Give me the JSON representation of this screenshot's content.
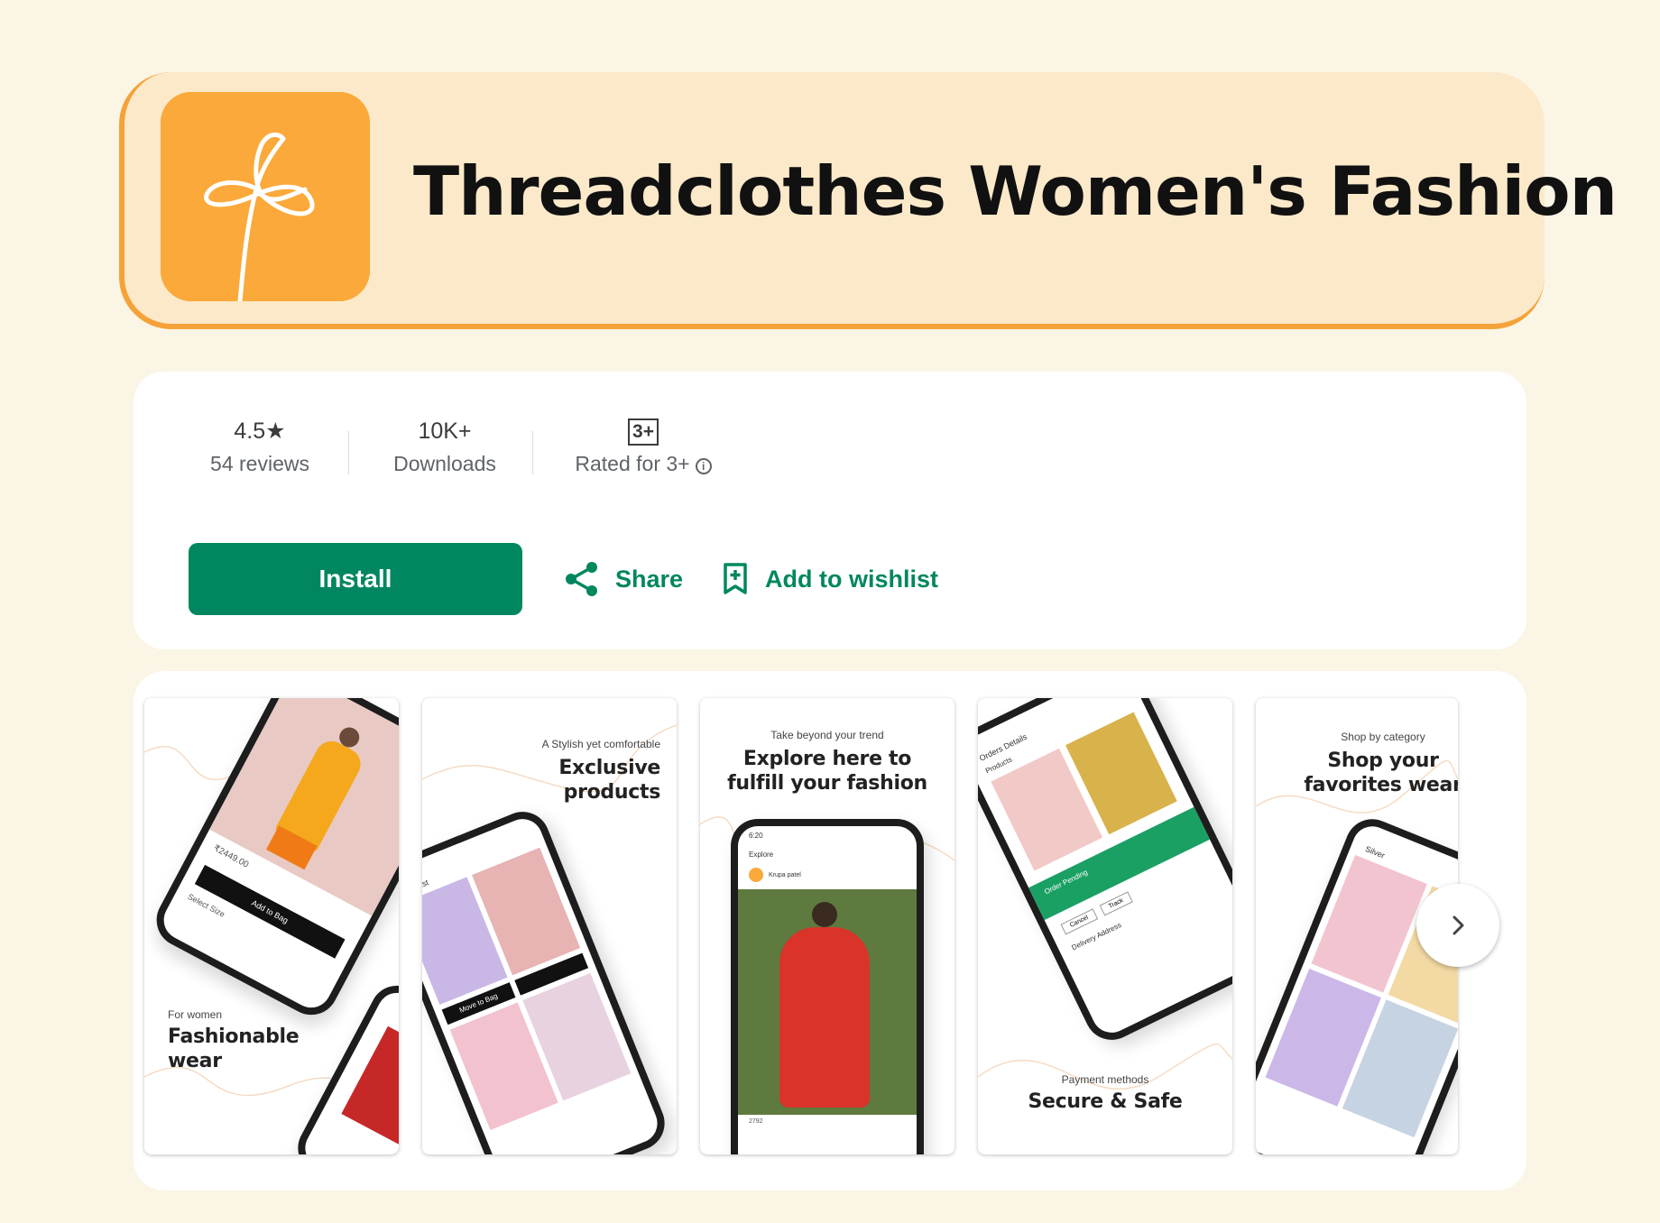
{
  "app": {
    "title": "Threadclothes Women's Fashion",
    "icon": "thread-bow-logo",
    "brand_color": "#fba93a"
  },
  "stats": {
    "rating_value": "4.5★",
    "rating_label": "54 reviews",
    "downloads_value": "10K+",
    "downloads_label": "Downloads",
    "age_badge": "3+",
    "age_label": "Rated for 3+"
  },
  "actions": {
    "install_label": "Install",
    "share_label": "Share",
    "wishlist_label": "Add to wishlist",
    "accent_color": "#01875f"
  },
  "screenshots": [
    {
      "small": "For women",
      "title_line1": "Fashionable",
      "title_line2": "wear",
      "ui_texts": [
        "Add to Bag",
        "Select Size",
        "₹2449.00"
      ]
    },
    {
      "small": "A Stylish yet comfortable",
      "title_line1": "Exclusive",
      "title_line2": "products",
      "ui_texts": [
        "Wishlist",
        "Move to Bag"
      ]
    },
    {
      "small": "Take beyond your trend",
      "title_line1": "Explore here to",
      "title_line2": "fulfill your fashion",
      "ui_texts": [
        "6:20",
        "Explore",
        "Krupa patel",
        "2792"
      ]
    },
    {
      "small": "Payment methods",
      "title_line1": "Secure & Safe",
      "title_line2": "",
      "ui_texts": [
        "Orders Details",
        "Products",
        "Order Pending",
        "Cancel",
        "Track",
        "Delivery Address"
      ]
    },
    {
      "small": "Shop by category",
      "title_line1": "Shop your",
      "title_line2": "favorites wear",
      "ui_texts": [
        "Silver"
      ]
    }
  ],
  "carousel": {
    "next_icon": "chevron-right-icon"
  }
}
